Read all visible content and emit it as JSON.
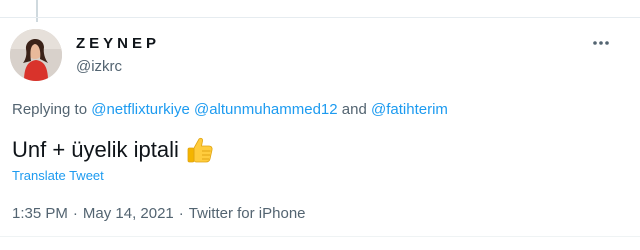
{
  "tweet": {
    "display_name": "ZEYNEP",
    "handle": "@izkrc",
    "avatar": "user-avatar-photo",
    "more_icon": "more-horizontal-icon",
    "replying_prefix": "Replying to",
    "mentions": [
      "@netflixturkiye",
      "@altunmuhammed12",
      "@fatihterim"
    ],
    "mention_joiner": "and",
    "text": "Unf + üyelik iptali",
    "emoji_icon": "thumbs-up-emoji-icon",
    "translate_label": "Translate Tweet",
    "time": "1:35 PM",
    "date": "May 14, 2021",
    "source": "Twitter for iPhone",
    "meta_separator": "·"
  },
  "colors": {
    "link": "#1d9bf0",
    "secondary_text": "#536471",
    "primary_text": "#0f1419",
    "divider": "#e6ecf0"
  }
}
